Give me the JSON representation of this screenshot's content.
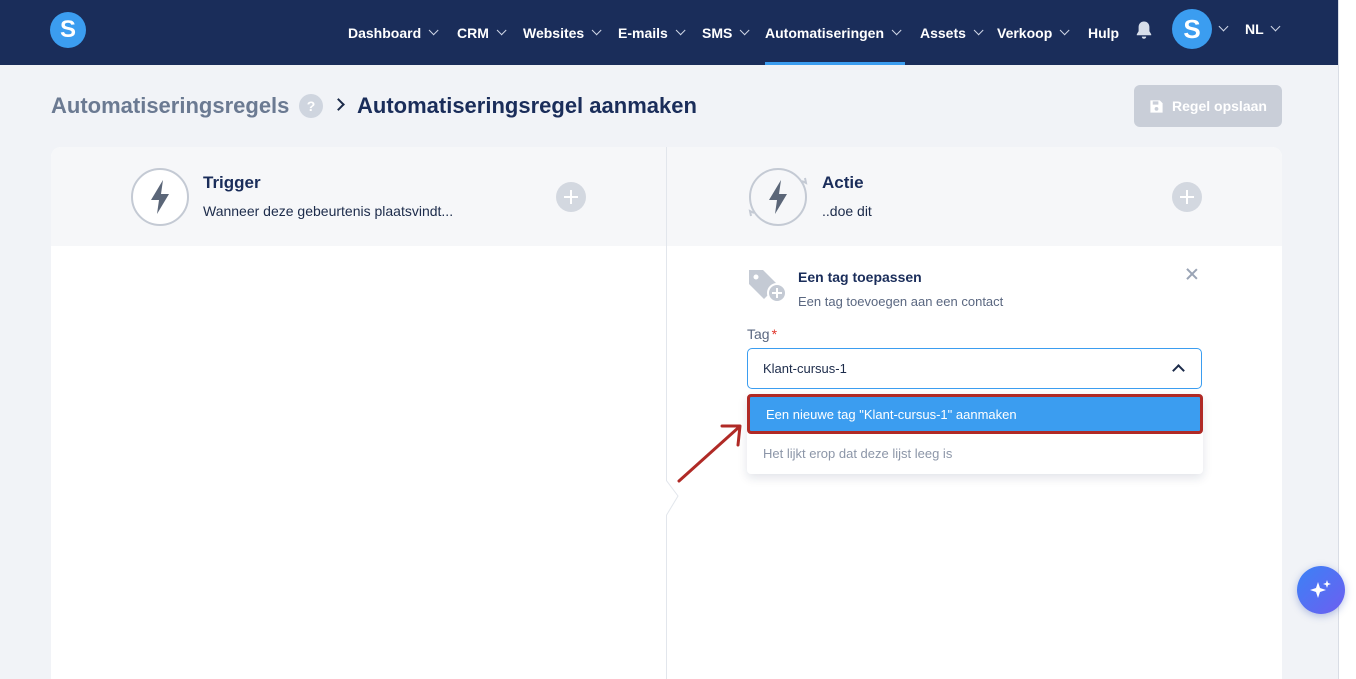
{
  "brand": {
    "logo_letter": "S",
    "accent": "#3b9df0",
    "nav_bg": "#1a2d5a"
  },
  "nav": {
    "items": [
      {
        "label": "Dashboard",
        "has_menu": true
      },
      {
        "label": "CRM",
        "has_menu": true
      },
      {
        "label": "Websites",
        "has_menu": true
      },
      {
        "label": "E-mails",
        "has_menu": true
      },
      {
        "label": "SMS",
        "has_menu": true
      },
      {
        "label": "Automatiseringen",
        "has_menu": true,
        "active": true
      },
      {
        "label": "Assets",
        "has_menu": true
      },
      {
        "label": "Verkoop",
        "has_menu": true
      },
      {
        "label": "Hulp",
        "has_menu": false
      }
    ],
    "notifications_icon": "bell-icon",
    "avatar_letter": "S",
    "language": "NL"
  },
  "breadcrumb": {
    "parent": "Automatiseringsregels",
    "help": "?",
    "current": "Automatiseringsregel aanmaken"
  },
  "toolbar": {
    "save_label": "Regel opslaan",
    "save_icon": "floppy-disk-icon"
  },
  "trigger": {
    "title": "Trigger",
    "subtitle": "Wanneer deze gebeurtenis plaatsvindt..."
  },
  "action": {
    "title": "Actie",
    "subtitle": "..doe dit",
    "card": {
      "icon": "tag-add-icon",
      "title": "Een tag toepassen",
      "subtitle": "Een tag toevoegen aan een contact",
      "field_label": "Tag",
      "required_mark": "*",
      "value": "Klant-cursus-1",
      "dropdown": {
        "create_option": "Een nieuwe tag \"Klant-cursus-1\" aanmaken",
        "empty_text": "Het lijkt erop dat deze lijst leeg is"
      }
    }
  },
  "assistant": {
    "icon": "sparkles-icon"
  }
}
